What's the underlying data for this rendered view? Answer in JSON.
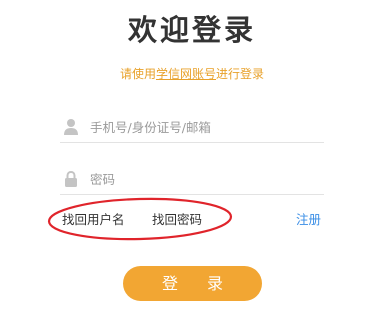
{
  "header": {
    "title": "欢迎登录",
    "subtitle_prefix": "请使用",
    "subtitle_link": "学信网账号",
    "subtitle_suffix": "进行登录"
  },
  "form": {
    "username": {
      "value": "",
      "placeholder": "手机号/身份证号/邮箱",
      "icon": "user-icon"
    },
    "password": {
      "value": "",
      "placeholder": "密码",
      "icon": "lock-icon"
    }
  },
  "links": {
    "find_username": "找回用户名",
    "find_password": "找回密码",
    "register": "注册"
  },
  "login_button": "登 录",
  "colors": {
    "accent": "#f2a633",
    "subtitle": "#e8a12a",
    "link_blue": "#3a8ee6",
    "annotation_red": "#e0242b"
  }
}
